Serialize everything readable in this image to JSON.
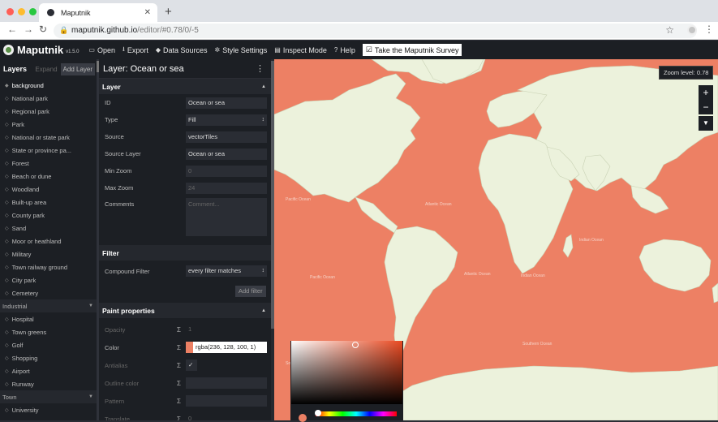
{
  "browser": {
    "tab_title": "Maputnik",
    "new_tab_symbol": "+",
    "tab_close_symbol": "✕",
    "url_host": "maputnik.github.io",
    "url_path": "/editor/#0.78/0/-5"
  },
  "app": {
    "name": "Maputnik",
    "version": "v1.5.0"
  },
  "toolbar": {
    "items": [
      {
        "label": "Open",
        "icon": "folder-icon"
      },
      {
        "label": "Export",
        "icon": "download-icon"
      },
      {
        "label": "Data Sources",
        "icon": "layers-icon"
      },
      {
        "label": "Style Settings",
        "icon": "gear-icon"
      },
      {
        "label": "Inspect Mode",
        "icon": "document-icon"
      },
      {
        "label": "Help",
        "icon": "question-icon"
      }
    ],
    "survey_label": "Take the Maputnik Survey"
  },
  "layers_panel": {
    "title": "Layers",
    "expand_label": "Expand",
    "add_label": "Add Layer",
    "items": [
      {
        "label": "background",
        "type": "item",
        "selected": true
      },
      {
        "label": "National park",
        "type": "item"
      },
      {
        "label": "Regional park",
        "type": "item"
      },
      {
        "label": "Park",
        "type": "item"
      },
      {
        "label": "National or state park",
        "type": "item"
      },
      {
        "label": "State or province pa...",
        "type": "item"
      },
      {
        "label": "Forest",
        "type": "item"
      },
      {
        "label": "Beach or dune",
        "type": "item"
      },
      {
        "label": "Woodland",
        "type": "item"
      },
      {
        "label": "Built-up area",
        "type": "item"
      },
      {
        "label": "County park",
        "type": "item"
      },
      {
        "label": "Sand",
        "type": "item"
      },
      {
        "label": "Moor or heathland",
        "type": "item"
      },
      {
        "label": "Military",
        "type": "item"
      },
      {
        "label": "Town railway ground",
        "type": "item"
      },
      {
        "label": "City park",
        "type": "item"
      },
      {
        "label": "Cemetery",
        "type": "item"
      },
      {
        "label": "Industrial",
        "type": "group"
      },
      {
        "label": "Hospital",
        "type": "item"
      },
      {
        "label": "Town greens",
        "type": "item"
      },
      {
        "label": "Golf",
        "type": "item"
      },
      {
        "label": "Shopping",
        "type": "item"
      },
      {
        "label": "Airport",
        "type": "item"
      },
      {
        "label": "Runway",
        "type": "item"
      },
      {
        "label": "Town",
        "type": "group"
      },
      {
        "label": "University",
        "type": "item"
      }
    ]
  },
  "editor": {
    "title": "Layer: Ocean or sea",
    "layer_section": {
      "title": "Layer",
      "fields": [
        {
          "label": "ID",
          "value": "Ocean or sea",
          "kind": "text"
        },
        {
          "label": "Type",
          "value": "Fill",
          "kind": "select"
        },
        {
          "label": "Source",
          "value": "vectorTiles",
          "kind": "text"
        },
        {
          "label": "Source Layer",
          "value": "Ocean or sea",
          "kind": "text"
        },
        {
          "label": "Min Zoom",
          "value": "0",
          "kind": "text",
          "dim": true
        },
        {
          "label": "Max Zoom",
          "value": "24",
          "kind": "text",
          "dim": true
        }
      ],
      "comments_label": "Comments",
      "comments_placeholder": "Comment..."
    },
    "filter_section": {
      "title": "Filter",
      "compound_label": "Compound Filter",
      "compound_value": "every filter matches",
      "add_filter_label": "Add filter"
    },
    "paint_section": {
      "title": "Paint properties",
      "sigma": "Σ",
      "fields": [
        {
          "label": "Opacity",
          "value": "1",
          "dim": true
        },
        {
          "label": "Color",
          "value": "rgba(236, 128, 100, 1)",
          "dim": false
        },
        {
          "label": "Antialias",
          "value": "✓",
          "dim": true
        },
        {
          "label": "Outline color",
          "value": "",
          "dim": true
        },
        {
          "label": "Pattern",
          "value": "",
          "dim": true
        },
        {
          "label": "Translate",
          "value": "0",
          "dim": true
        }
      ]
    }
  },
  "map": {
    "zoom_label": "Zoom level: 0.78",
    "zoom_in": "+",
    "zoom_out": "−",
    "compass": "▼",
    "ocean_color": "#ec8064",
    "land_color": "#ecf2dc",
    "sea_labels": [
      "Pacific Ocean",
      "Atlantic Ocean",
      "Indian Ocean",
      "Pacific Ocean",
      "Atlantic Ocean",
      "Indian Ocean",
      "Southern Ocean",
      "Southern Ocean"
    ]
  },
  "color_picker": {
    "current_color": "#ec8064"
  }
}
